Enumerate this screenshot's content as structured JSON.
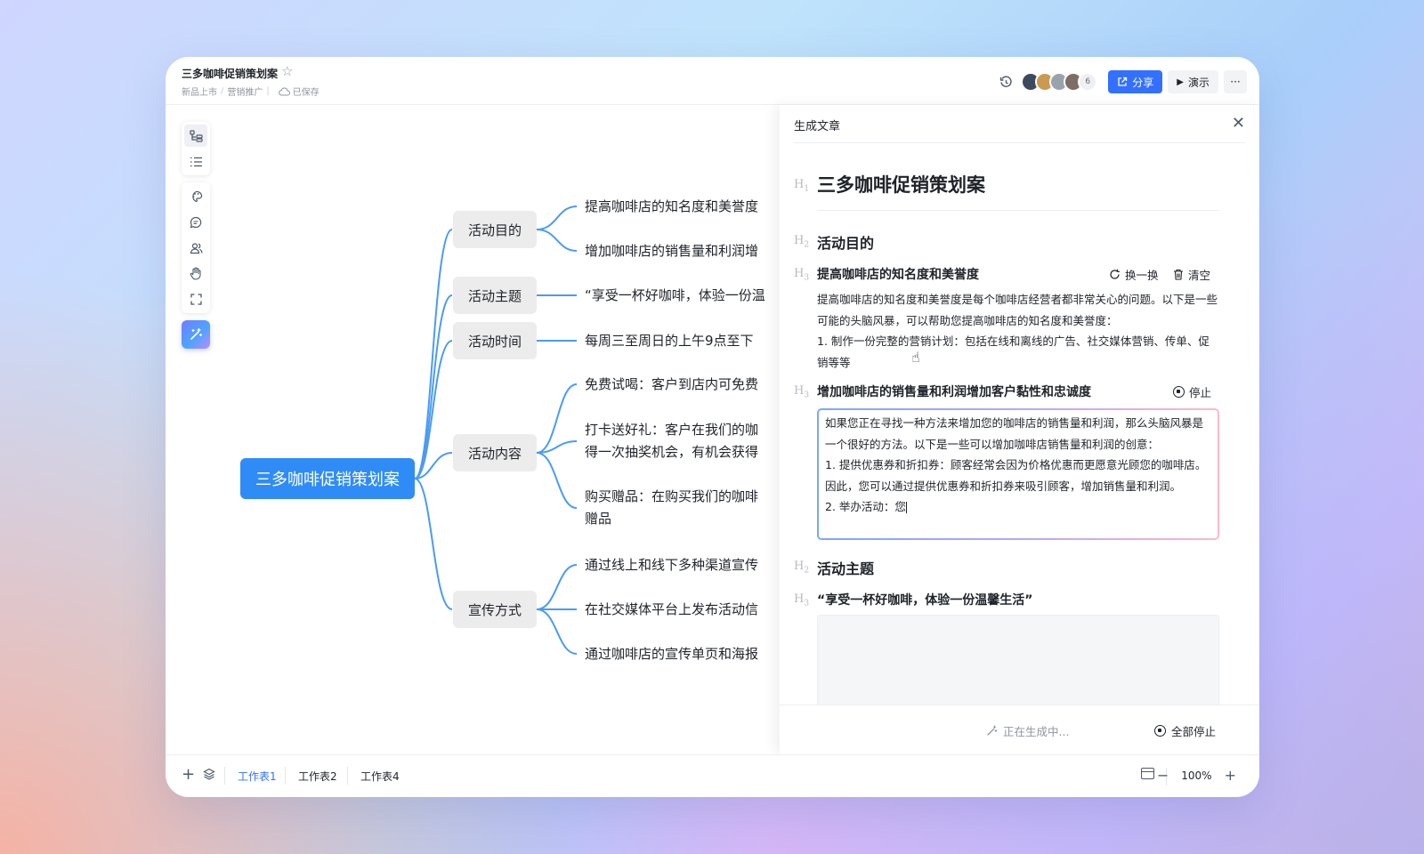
{
  "header": {
    "title": "三多咖啡促销策划案",
    "breadcrumb": [
      "新品上市",
      "营销推广"
    ],
    "saved_label": "已保存",
    "collaborator_count": "6",
    "share_label": "分享",
    "present_label": "演示",
    "more_label": "···"
  },
  "mindmap": {
    "root": "三多咖啡促销策划案",
    "branches": [
      "活动目的",
      "活动主题",
      "活动时间",
      "活动内容",
      "宣传方式"
    ],
    "leaves": [
      "提高咖啡店的知名度和美誉度",
      "增加咖啡店的销售量和利润增",
      "“享受一杯好咖啡，体验一份温",
      "每周三至周日的上午9点至下",
      "免费试喝：客户到店内可免费",
      "打卡送好礼：客户在我们的咖",
      "得一次抽奖机会，有机会获得",
      "购买赠品：在购买我们的咖啡",
      "赠品",
      "通过线上和线下多种渠道宣传",
      "在社交媒体平台上发布活动信",
      "通过咖啡店的宣传单页和海报"
    ]
  },
  "panel": {
    "title": "生成文章",
    "h1": "三多咖啡促销策划案",
    "section1_h2": "活动目的",
    "sub1_h3": "提高咖啡店的知名度和美誉度",
    "sub1_actions": {
      "refresh": "换一换",
      "clear": "清空"
    },
    "sub1_text": "提高咖啡店的知名度和美誉度是每个咖啡店经营者都非常关心的问题。以下是一些可能的头脑风暴，可以帮助您提高咖啡店的知名度和美誉度：",
    "sub1_item1": "1. 制作一份完整的营销计划：包括在线和离线的广告、社交媒体营销、传单、促销等等",
    "sub2_h3": "增加咖啡店的销售量和利润增加客户黏性和忠诚度",
    "sub2_stop": "停止",
    "sub2_text1": "如果您正在寻找一种方法来增加您的咖啡店的销售量和利润，那么头脑风暴是一个很好的方法。以下是一些可以增加咖啡店销售量和利润的创意：",
    "sub2_text2": "1. 提供优惠券和折扣券：顾客经常会因为价格优惠而更愿意光顾您的咖啡店。因此，您可以通过提供优惠券和折扣券来吸引顾客，增加销售量和利润。",
    "sub2_text3": "2. 举办活动：您",
    "section2_h2": "活动主题",
    "sub3_h3": "“享受一杯好咖啡，体验一份温馨生活”",
    "footer_generating": "正在生成中...",
    "footer_stop_all": "全部停止"
  },
  "bottombar": {
    "sheets": [
      "工作表1",
      "工作表2",
      "工作表4"
    ],
    "zoom": "100%"
  },
  "colors": {
    "accent": "#3370ff",
    "root_node": "#2f8cf7",
    "connector": "#4a9bf5",
    "branch_bg": "#ececed"
  }
}
